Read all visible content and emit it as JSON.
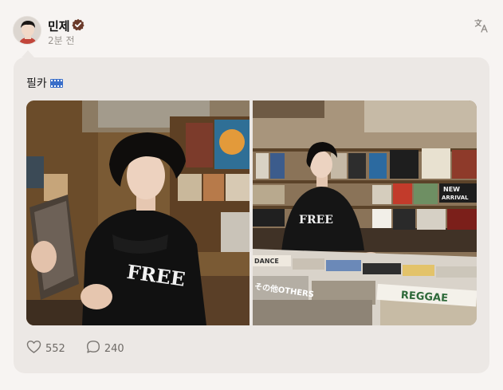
{
  "author": {
    "name": "민제",
    "time": "2분 전"
  },
  "post": {
    "text": "필카",
    "image_1_lettering": "FREE",
    "image_2_lettering": [
      "FREE",
      "NEW",
      "ARRIVAL",
      "REGGAE",
      "その他OTHERS",
      "DANCE"
    ]
  },
  "stats": {
    "likes": "552",
    "comments": "240"
  },
  "icons": {
    "verified": "verified-badge-icon",
    "translate": "translate-icon",
    "like": "heart-icon",
    "comment": "comment-bubble-icon"
  },
  "colors": {
    "background": "#f7f4f2",
    "card": "#ece8e5",
    "verified_badge": "#6b3a2a",
    "muted_text": "#9a9590"
  }
}
